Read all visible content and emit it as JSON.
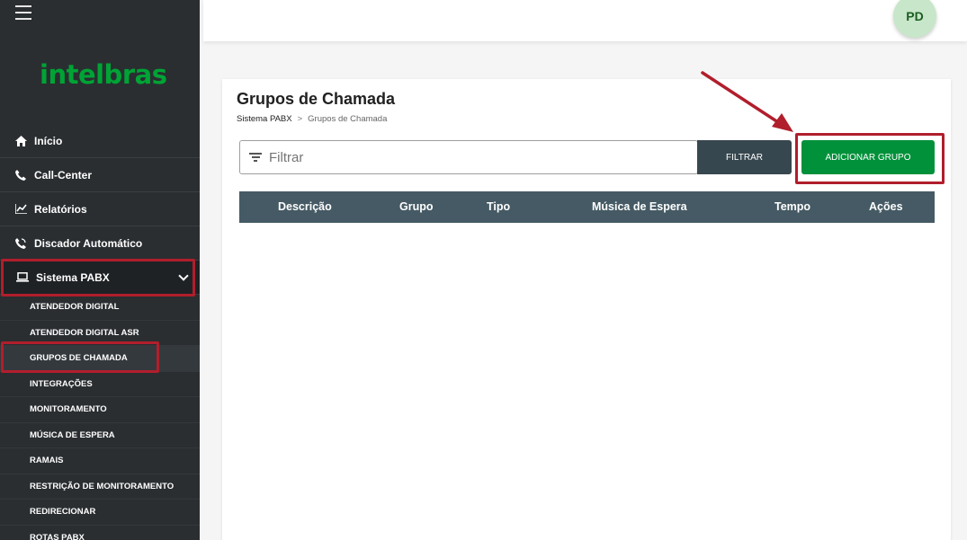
{
  "brand": {
    "logo_text": "intelbras",
    "color": "#00a335"
  },
  "user": {
    "initials": "PD"
  },
  "sidebar": {
    "menu_icon": "hamburger-icon",
    "items": [
      {
        "label": "Início",
        "icon": "home-icon"
      },
      {
        "label": "Call-Center",
        "icon": "phone-icon"
      },
      {
        "label": "Relatórios",
        "icon": "chart-icon"
      },
      {
        "label": "Discador Automático",
        "icon": "phone-dialer-icon"
      },
      {
        "label": "Sistema PABX",
        "icon": "laptop-icon",
        "expanded": true
      }
    ],
    "sub_items": [
      "ATENDEDOR DIGITAL",
      "ATENDEDOR DIGITAL ASR",
      "GRUPOS DE CHAMADA",
      "INTEGRAÇÕES",
      "MONITORAMENTO",
      "MÚSICA DE ESPERA",
      "RAMAIS",
      "RESTRIÇÃO DE MONITORAMENTO",
      "REDIRECIONAR",
      "ROTAS PABX"
    ],
    "selected_sub_item": "GRUPOS DE CHAMADA"
  },
  "page": {
    "title": "Grupos de Chamada",
    "breadcrumb": {
      "parent": "Sistema PABX",
      "separator": ">",
      "current": "Grupos de Chamada"
    }
  },
  "filter": {
    "placeholder": "Filtrar",
    "value": "",
    "button_label": "FILTRAR"
  },
  "add_button_label": "ADICIONAR GRUPO",
  "table": {
    "columns": [
      "Descrição",
      "Grupo",
      "Tipo",
      "Música de Espera",
      "Tempo",
      "Ações"
    ],
    "rows": []
  },
  "colors": {
    "accent_green": "#00913a",
    "header_dark": "#455a64",
    "highlight_red": "#b11e2c"
  }
}
